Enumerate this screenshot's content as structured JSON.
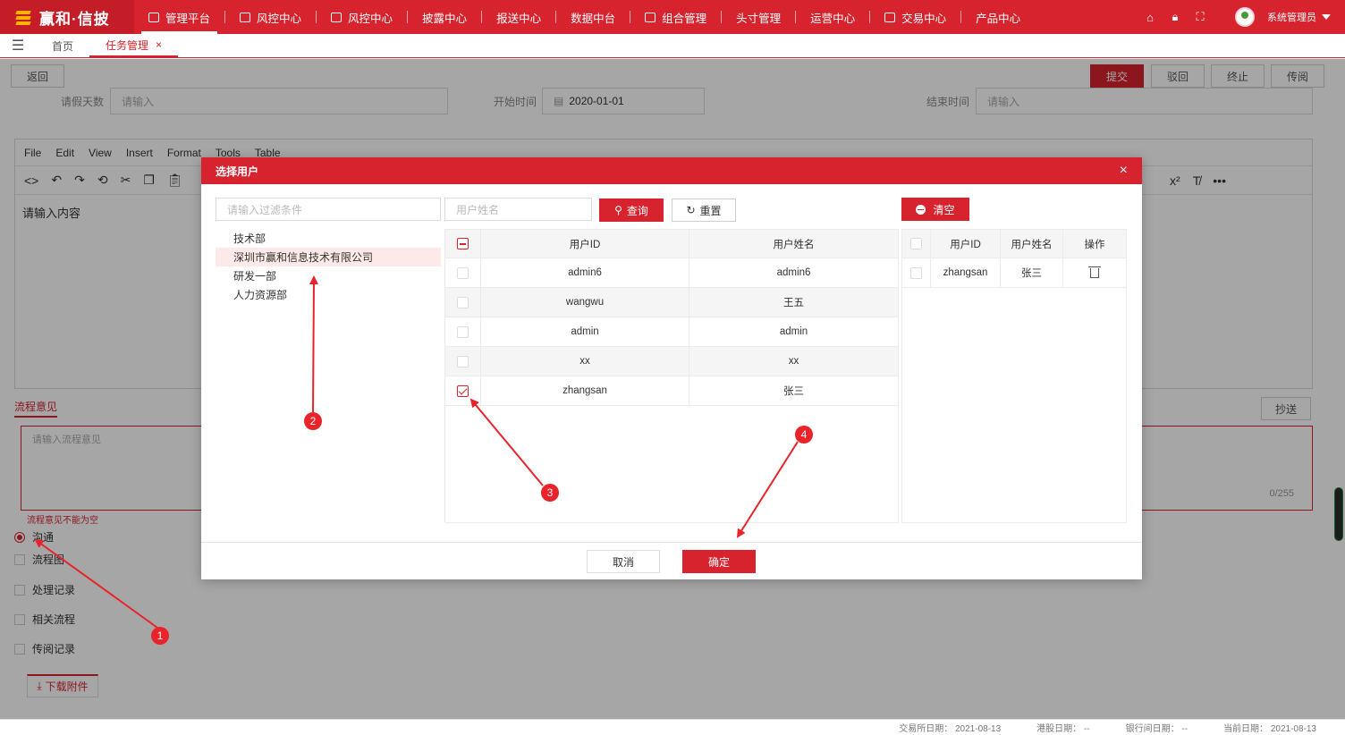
{
  "app": {
    "logo_text": "赢和·信披",
    "nav": [
      "管理平台",
      "风控中心",
      "风控中心",
      "披露中心",
      "报送中心",
      "数据中台",
      "组合管理",
      "头寸管理",
      "运营中心",
      "交易中心",
      "产品中心"
    ],
    "user_name": "系统管理员"
  },
  "tabs": {
    "home": "首页",
    "task": "任务管理",
    "close": "×"
  },
  "page": {
    "back": "返回",
    "submit": "提交",
    "reject": "驳回",
    "stop": "终止",
    "circulate": "传阅",
    "leave_days_label": "请假天数",
    "leave_days_placeholder": "请输入",
    "start_label": "开始时间",
    "start_value": "2020-01-01",
    "end_label": "结束时间",
    "end_placeholder": "请输入",
    "editor_menu": [
      "File",
      "Edit",
      "View",
      "Insert",
      "Format",
      "Tools",
      "Table"
    ],
    "editor_placeholder": "请输入内容",
    "flow_title": "流程意见",
    "cc": "抄送",
    "opinion_placeholder": "请输入流程意见",
    "opinion_count": "0/255",
    "error": "流程意见不能为空",
    "options": [
      "沟通",
      "流程图",
      "处理记录",
      "相关流程",
      "传阅记录"
    ],
    "download": "下载附件"
  },
  "footer": {
    "exchange_date": "交易所日期： 2021-08-13",
    "hk_date": "港股日期： --",
    "bank_date": "银行间日期： --",
    "current_date": "当前日期： 2021-08-13"
  },
  "modal": {
    "title": "选择用户",
    "close": "×",
    "filter_placeholder": "请输入过滤条件",
    "username_placeholder": "用户姓名",
    "search": "查询",
    "reset": "重置",
    "clear": "清空",
    "departments": [
      "技术部",
      "深圳市赢和信息技术有限公司",
      "研发一部",
      "人力资源部"
    ],
    "user_table": {
      "headers": [
        "用户ID",
        "用户姓名"
      ],
      "rows": [
        {
          "id": "admin6",
          "name": "admin6",
          "checked": false
        },
        {
          "id": "wangwu",
          "name": "王五",
          "checked": false
        },
        {
          "id": "admin",
          "name": "admin",
          "checked": false
        },
        {
          "id": "xx",
          "name": "xx",
          "checked": false
        },
        {
          "id": "zhangsan",
          "name": "张三",
          "checked": true
        }
      ]
    },
    "selected_table": {
      "headers": [
        "用户ID",
        "用户姓名",
        "操作"
      ],
      "rows": [
        {
          "id": "zhangsan",
          "name": "张三"
        }
      ]
    },
    "cancel": "取消",
    "ok": "确定"
  },
  "annotations": [
    "1",
    "2",
    "3",
    "4"
  ],
  "colors": {
    "brand": "#d6232e",
    "arrow": "#e8232a"
  }
}
